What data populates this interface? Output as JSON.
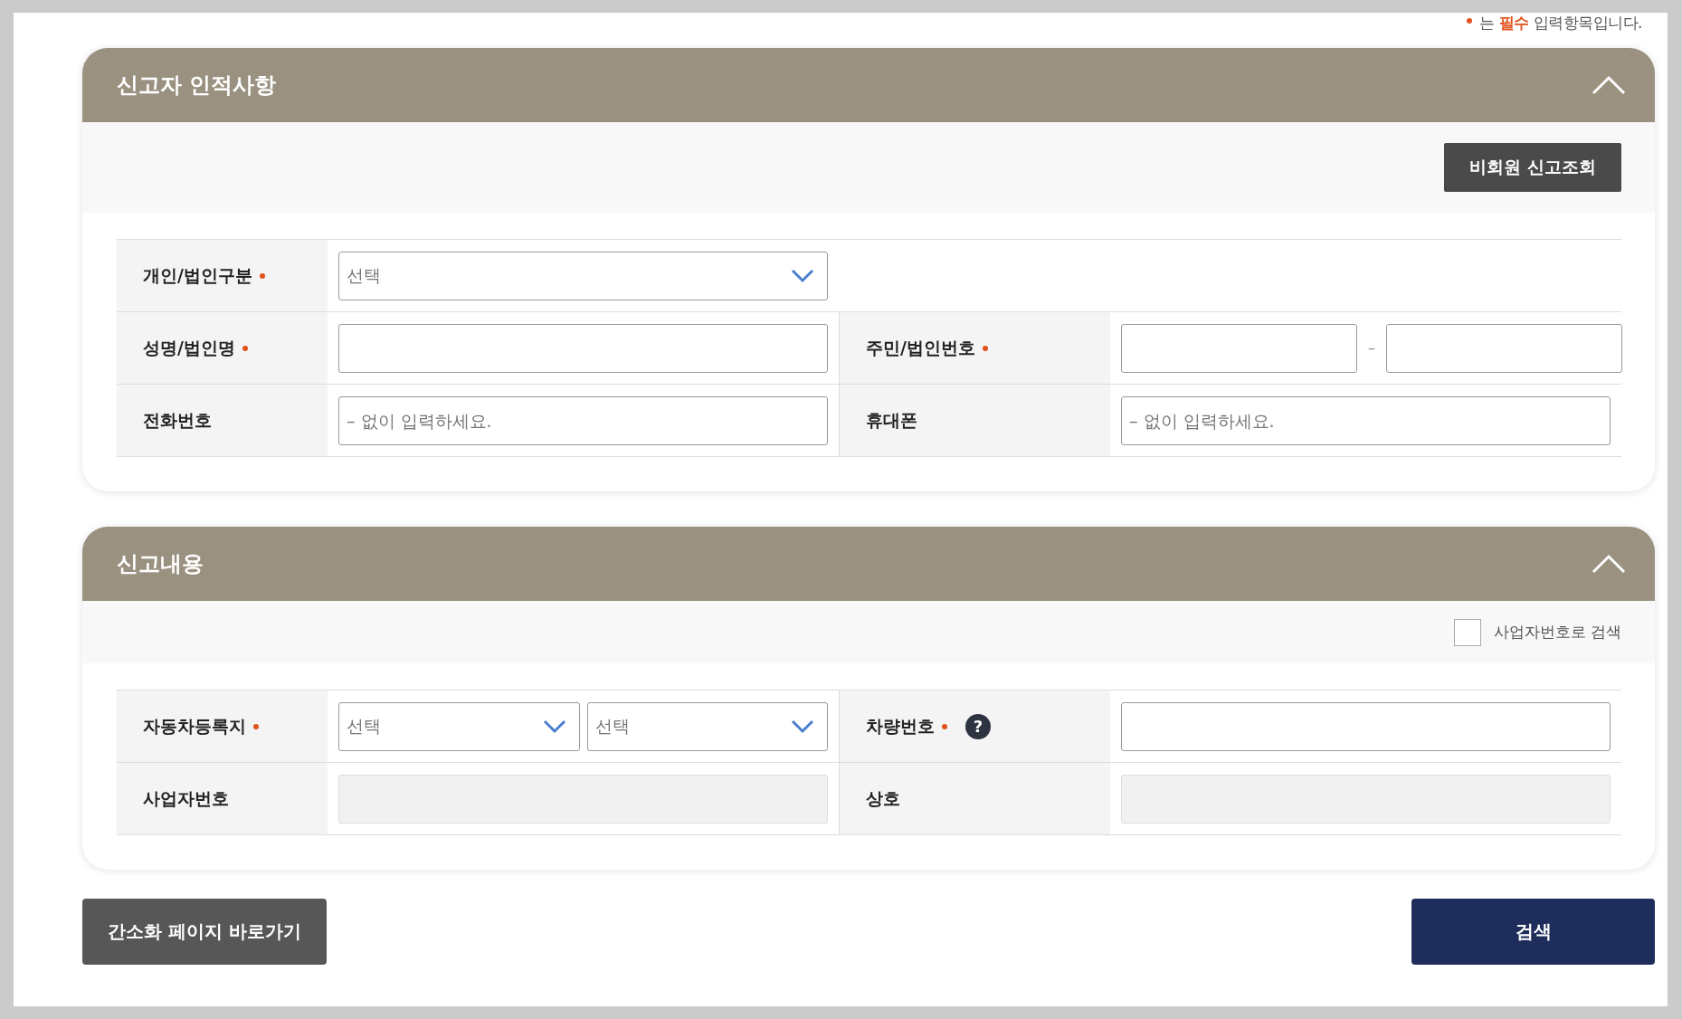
{
  "notice": "는 **필수** 입력항목입니다.",
  "sections": [
    {
      "title": "신고자 인적사항",
      "expanded": true,
      "toolbar": {
        "kind": "button",
        "label": "비회원 신고조회"
      },
      "rows": [
        [
          {
            "label": "개인/법인구분",
            "required": true,
            "control": {
              "kind": "select",
              "options": [
                "선택"
              ]
            }
          }
        ],
        [
          {
            "label": "성명/법인명",
            "required": true,
            "control": {
              "kind": "input"
            }
          },
          {
            "label": "주민/법인번호",
            "required": true,
            "control": {
              "kind": "split",
              "separator": "–"
            }
          }
        ],
        [
          {
            "label": "전화번호",
            "required": false,
            "control": {
              "kind": "input",
              "placeholder": "– 없이 입력하세요."
            }
          },
          {
            "label": "휴대폰",
            "required": false,
            "control": {
              "kind": "input",
              "placeholder": "– 없이 입력하세요."
            }
          }
        ]
      ]
    },
    {
      "title": "신고내용",
      "expanded": true,
      "toolbar": {
        "kind": "checkbox",
        "label": "사업자번호로 검색",
        "checked": false
      },
      "rows": [
        [
          {
            "label": "자동차등록지",
            "required": true,
            "control": {
              "kind": "select",
              "options": [
                "선택",
                "선택"
              ]
            }
          },
          {
            "label": "차량번호",
            "required": true,
            "help": "?",
            "control": {
              "kind": "input"
            }
          }
        ],
        [
          {
            "label": "사업자번호",
            "required": false,
            "control": {
              "kind": "input",
              "disabled": true
            }
          },
          {
            "label": "상호",
            "required": false,
            "control": {
              "kind": "input",
              "disabled": true
            }
          }
        ]
      ]
    }
  ],
  "buttons": [
    {
      "label": "간소화 페이지 바로가기",
      "kind": "secondary"
    },
    {
      "label": "검색",
      "kind": "primary"
    }
  ]
}
